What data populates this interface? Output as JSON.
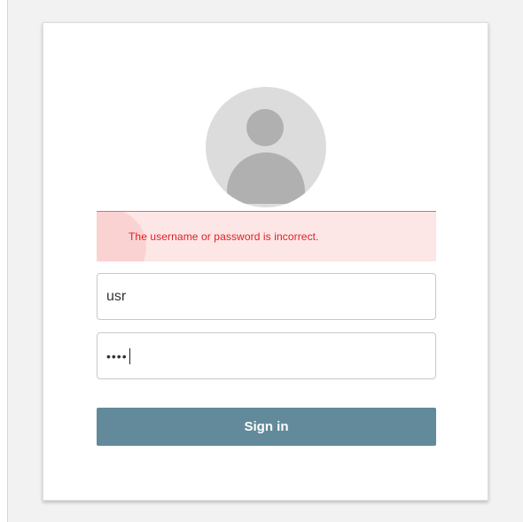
{
  "login": {
    "error_message": "The username or password is incorrect.",
    "username_value": "usr",
    "password_mask": "••••",
    "signin_label": "Sign in"
  },
  "icons": {
    "avatar": "user-avatar-icon",
    "error": "chevron-left-icon"
  },
  "colors": {
    "error_text": "#e02020",
    "error_bg": "#fde6e6",
    "button_bg": "#628a9a",
    "avatar_bg": "#dcdcdc"
  }
}
